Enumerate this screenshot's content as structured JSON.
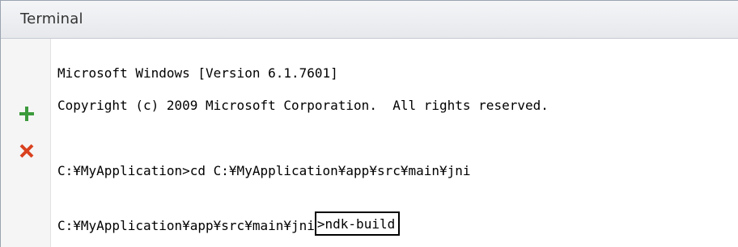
{
  "panel": {
    "title": "Terminal"
  },
  "toolbar": {
    "add_icon": "plus-icon",
    "add_color": "#3c9a3c",
    "close_icon": "close-icon",
    "close_color": "#d9411e"
  },
  "console": {
    "lines": [
      "Microsoft Windows [Version 6.1.7601]",
      "Copyright (c) 2009 Microsoft Corporation.  All rights reserved.",
      "C:¥MyApplication>cd C:¥MyApplication¥app¥src¥main¥jni"
    ],
    "prompt": "C:¥MyApplication¥app¥src¥main¥jni",
    "current_command": ">ndk-build"
  }
}
